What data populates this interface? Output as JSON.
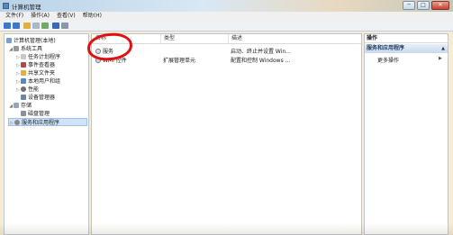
{
  "window": {
    "title": "计算机管理",
    "minimize": "─",
    "maximize": "□",
    "close": "✕"
  },
  "menu": [
    "文件(F)",
    "操作(A)",
    "查看(V)",
    "帮助(H)"
  ],
  "tree": {
    "root": "计算机管理(本地)",
    "system_tools": "系统工具",
    "task_scheduler": "任务计划程序",
    "event_viewer": "事件查看器",
    "shared_folders": "共享文件夹",
    "local_users": "本地用户和组",
    "performance": "性能",
    "device_manager": "设备管理器",
    "storage": "存储",
    "disk_management": "磁盘管理",
    "services_apps": "服务和应用程序"
  },
  "list": {
    "headers": {
      "name": "名称",
      "type": "类型",
      "description": "描述"
    },
    "rows": [
      {
        "name": "服务",
        "type": "",
        "description": "启动、终止并设置 Win..."
      },
      {
        "name": "WMI 控件",
        "type": "扩展管理单元",
        "description": "配置和控制 Windows ..."
      }
    ]
  },
  "actions": {
    "title": "操作",
    "section": "服务和应用程序",
    "more": "更多操作"
  },
  "colors": {
    "annotation": "#e01010",
    "selection": "#cfe3f8"
  }
}
